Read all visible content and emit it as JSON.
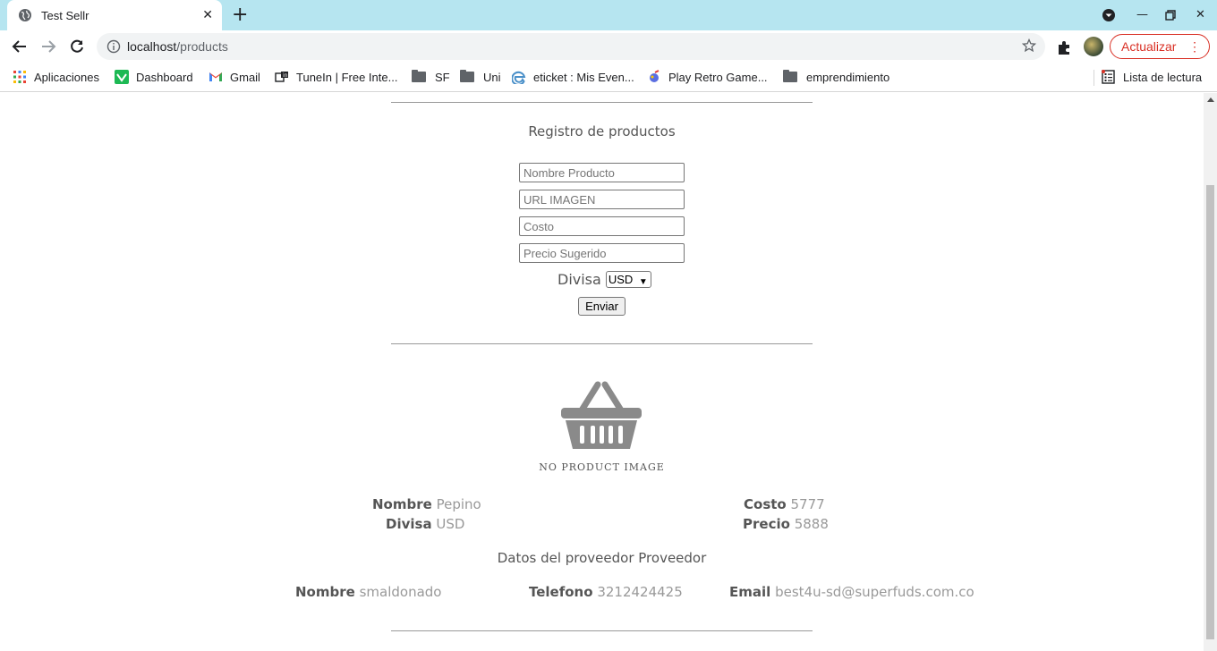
{
  "browser": {
    "tab_title": "Test Sellr",
    "url_host": "localhost",
    "url_path": "/products",
    "update_label": "Actualizar"
  },
  "bookmarks": {
    "items": [
      {
        "label": "Aplicaciones",
        "icon": "apps-grid-icon"
      },
      {
        "label": "Dashboard",
        "icon": "dashboard-icon"
      },
      {
        "label": "Gmail",
        "icon": "gmail-icon"
      },
      {
        "label": "TuneIn | Free Inte...",
        "icon": "tunein-icon"
      },
      {
        "label": "SF",
        "icon": "folder-icon"
      },
      {
        "label": "Uni",
        "icon": "folder-icon"
      },
      {
        "label": "eticket : Mis Even...",
        "icon": "edge-icon"
      },
      {
        "label": "Play Retro Game...",
        "icon": "game-icon"
      },
      {
        "label": "emprendimiento",
        "icon": "folder-icon"
      }
    ],
    "reading_list": "Lista de lectura"
  },
  "form": {
    "title": "Registro de productos",
    "name_placeholder": "Nombre Producto",
    "image_placeholder": "URL IMAGEN",
    "cost_placeholder": "Costo",
    "price_placeholder": "Precio Sugerido",
    "currency_label": "Divisa",
    "currency_value": "USD",
    "submit_label": "Enviar"
  },
  "product": {
    "no_image_text": "NO PRODUCT IMAGE",
    "name_key": "Nombre",
    "name_value": "Pepino",
    "currency_key": "Divisa",
    "currency_value": "USD",
    "cost_key": "Costo",
    "cost_value": "5777",
    "price_key": "Precio",
    "price_value": "5888"
  },
  "provider": {
    "title": "Datos del proveedor Proveedor",
    "name_key": "Nombre",
    "name_value": "smaldonado",
    "phone_key": "Telefono",
    "phone_value": "3212424425",
    "email_key": "Email",
    "email_value": "best4u-sd@superfuds.com.co"
  },
  "colors": {
    "tabstrip": "#b6e5f0",
    "update_accent": "#d93025"
  }
}
